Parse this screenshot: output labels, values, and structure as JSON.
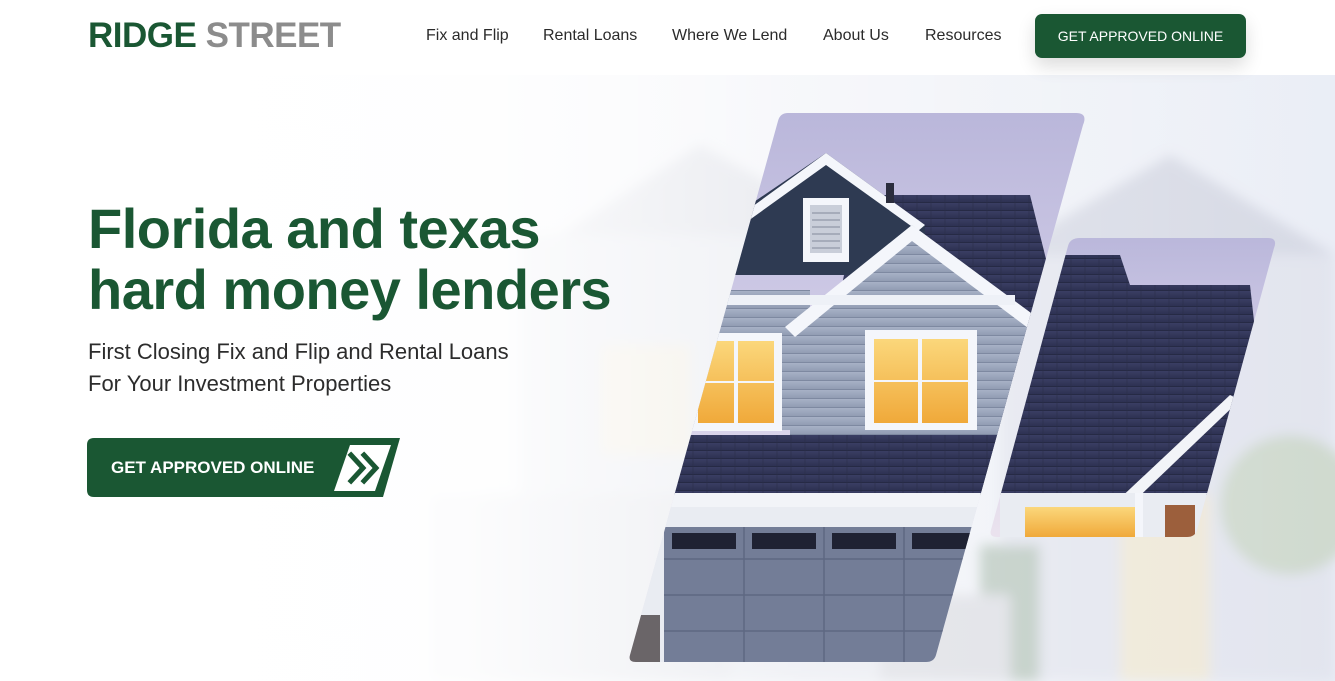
{
  "brand": {
    "name_primary": "RIDGE",
    "name_secondary": "STREET"
  },
  "nav": {
    "items": [
      {
        "label": "Fix and Flip"
      },
      {
        "label": "Rental Loans"
      },
      {
        "label": "Where We Lend"
      },
      {
        "label": "About Us"
      },
      {
        "label": "Resources"
      }
    ],
    "cta_label": "GET APPROVED ONLINE"
  },
  "hero": {
    "headline_line1": "Florida and texas",
    "headline_line2": "hard money lenders",
    "subline_line1": "First Closing Fix and Flip and Rental Loans",
    "subline_line2": "For Your Investment Properties",
    "cta_label": "GET APPROVED ONLINE",
    "cta_icon": "double-chevron-right-icon",
    "image": "house-exterior-photo"
  },
  "colors": {
    "brand_green": "#1a5733",
    "brand_gray": "#8c8c8c",
    "text_dark": "#2c2c2c",
    "roof": "#3b3f63",
    "siding": "#9aa6bd",
    "window_glow": "#f7c35a"
  }
}
